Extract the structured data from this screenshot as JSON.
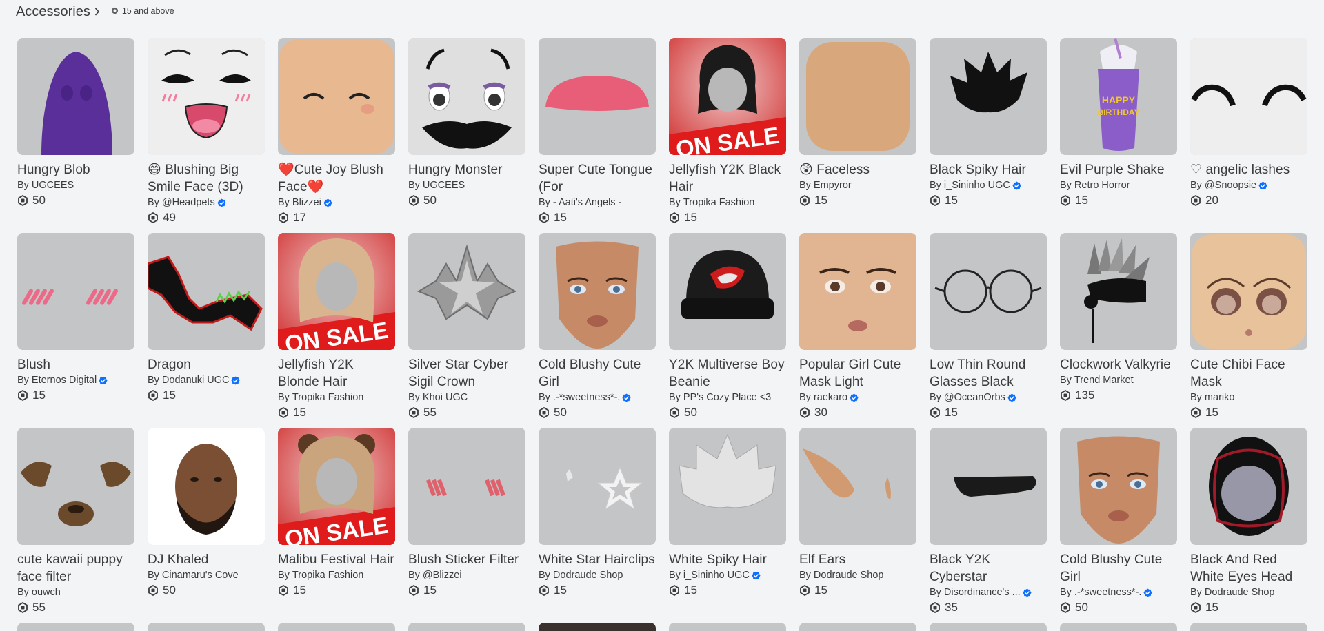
{
  "header": {
    "title": "Accessories",
    "rating": "15 and above"
  },
  "items": [
    {
      "name": "Hungry Blob",
      "by": "By",
      "creator": "UGCEES",
      "verified": false,
      "price": "50",
      "art": "blob"
    },
    {
      "name": "😄 Blushing Big Smile Face (3D)",
      "by": "By",
      "creator": "@Headpets",
      "verified": true,
      "price": "49",
      "art": "smileface"
    },
    {
      "name": "❤️Cute Joy Blush Face❤️",
      "by": "By",
      "creator": "Blizzei",
      "verified": true,
      "price": "17",
      "art": "joyface"
    },
    {
      "name": "Hungry Monster",
      "by": "By",
      "creator": "UGCEES",
      "verified": false,
      "price": "50",
      "art": "monster"
    },
    {
      "name": "Super Cute Tongue (For",
      "by": "By",
      "creator": "- Aati's Angels -",
      "verified": false,
      "price": "15",
      "art": "tongue"
    },
    {
      "name": "Jellyfish Y2K Black Hair",
      "by": "By",
      "creator": "Tropika Fashion",
      "verified": false,
      "price": "15",
      "art": "sale-black",
      "sale_text": "ON SALE"
    },
    {
      "name": "😲 Faceless",
      "by": "By",
      "creator": "Empyror",
      "verified": false,
      "price": "15",
      "art": "faceless"
    },
    {
      "name": "Black Spiky Hair",
      "by": "By",
      "creator": "i_Sininho UGC",
      "verified": true,
      "price": "15",
      "art": "spiky-black"
    },
    {
      "name": "Evil Purple Shake",
      "by": "By",
      "creator": "Retro Horror",
      "verified": false,
      "price": "15",
      "art": "shake"
    },
    {
      "name": "♡ angelic lashes",
      "by": "By",
      "creator": "@Snoopsie",
      "verified": true,
      "price": "20",
      "art": "lashes"
    },
    {
      "name": "Blush",
      "by": "By",
      "creator": "Eternos Digital",
      "verified": true,
      "price": "15",
      "art": "blush"
    },
    {
      "name": "Dragon",
      "by": "By",
      "creator": "Dodanuki UGC",
      "verified": true,
      "price": "15",
      "art": "dragon"
    },
    {
      "name": "Jellyfish Y2K Blonde Hair",
      "by": "By",
      "creator": "Tropika Fashion",
      "verified": false,
      "price": "15",
      "art": "sale-blonde",
      "sale_text": "ON SALE"
    },
    {
      "name": "Silver Star Cyber Sigil Crown",
      "by": "By",
      "creator": "Khoi UGC",
      "verified": false,
      "price": "55",
      "art": "crown"
    },
    {
      "name": "Cold Blushy Cute Girl",
      "by": "By",
      "creator": ".-*sweetness*-.",
      "verified": true,
      "price": "50",
      "art": "girlface"
    },
    {
      "name": "Y2K Multiverse Boy Beanie",
      "by": "By",
      "creator": "PP's Cozy Place <3",
      "verified": false,
      "price": "50",
      "art": "beanie"
    },
    {
      "name": "Popular Girl Cute Mask Light",
      "by": "By",
      "creator": "raekaro",
      "verified": true,
      "price": "30",
      "art": "popgirl"
    },
    {
      "name": "Low Thin Round Glasses Black",
      "by": "By",
      "creator": "@OceanOrbs",
      "verified": true,
      "price": "15",
      "art": "glasses"
    },
    {
      "name": "Clockwork Valkyrie",
      "by": "By",
      "creator": "Trend Market",
      "verified": false,
      "price": "135",
      "art": "valkyrie"
    },
    {
      "name": "Cute Chibi Face Mask",
      "by": "By",
      "creator": "mariko",
      "verified": false,
      "price": "15",
      "art": "chibi"
    },
    {
      "name": "cute kawaii puppy face filter",
      "by": "By",
      "creator": "ouwch",
      "verified": false,
      "price": "55",
      "art": "puppy"
    },
    {
      "name": "DJ Khaled",
      "by": "By",
      "creator": "Cinamaru's Cove",
      "verified": false,
      "price": "50",
      "art": "khaled"
    },
    {
      "name": "Malibu Festival Hair",
      "by": "By",
      "creator": "Tropika Fashion",
      "verified": false,
      "price": "15",
      "art": "sale-malibu",
      "sale_text": "ON SALE"
    },
    {
      "name": "Blush Sticker Filter",
      "by": "By",
      "creator": "@Blizzei",
      "verified": false,
      "price": "15",
      "art": "blush2"
    },
    {
      "name": "White Star Hairclips",
      "by": "By",
      "creator": "Dodraude Shop",
      "verified": false,
      "price": "15",
      "art": "starclips"
    },
    {
      "name": "White Spiky Hair",
      "by": "By",
      "creator": "i_Sininho UGC",
      "verified": true,
      "price": "15",
      "art": "spiky-white"
    },
    {
      "name": "Elf Ears",
      "by": "By",
      "creator": "Dodraude Shop",
      "verified": false,
      "price": "15",
      "art": "elf"
    },
    {
      "name": "Black Y2K Cyberstar",
      "by": "By",
      "creator": "Disordinance's ...",
      "verified": true,
      "price": "35",
      "art": "cyberstar"
    },
    {
      "name": "Cold Blushy Cute Girl",
      "by": "By",
      "creator": ".-*sweetness*-.",
      "verified": true,
      "price": "50",
      "art": "girlface"
    },
    {
      "name": "Black And Red White Eyes Head",
      "by": "By",
      "creator": "Dodraude Shop",
      "verified": false,
      "price": "15",
      "art": "redhead"
    }
  ]
}
